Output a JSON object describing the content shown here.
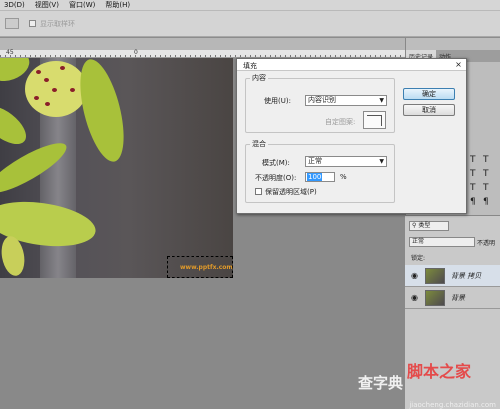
{
  "menubar": {
    "items": [
      "3D(D)",
      "视图(V)",
      "窗口(W)",
      "帮助(H)"
    ]
  },
  "optionsbar": {
    "checkbox_label": "显示取样环"
  },
  "ruler": {
    "labels": [
      "45",
      "0"
    ]
  },
  "canvas": {
    "watermark_text": "www.pptfx.com"
  },
  "dialog": {
    "title": "填充",
    "content_group": "内容",
    "use_label": "使用(U):",
    "use_value": "内容识别",
    "custom_pattern_label": "自定图案:",
    "blend_group": "混合",
    "mode_label": "模式(M):",
    "mode_value": "正常",
    "opacity_label": "不透明度(O):",
    "opacity_value": "100",
    "opacity_unit": "%",
    "preserve_label": "保留透明区域(P)",
    "ok_label": "确定",
    "cancel_label": "取消",
    "close_glyph": "×"
  },
  "rightpanel": {
    "tabs": [
      "历史记录",
      "动作"
    ],
    "kind_label": "类型",
    "blend_mode": "正常",
    "opacity_short": "不透明",
    "lock_label": "锁定:"
  },
  "layers": [
    {
      "name": "背景 拷贝"
    },
    {
      "name": "背景"
    }
  ],
  "watermarks": {
    "brand": "脚本之家",
    "site": "查字典",
    "url": "jiaocheng.chazidian.com"
  }
}
